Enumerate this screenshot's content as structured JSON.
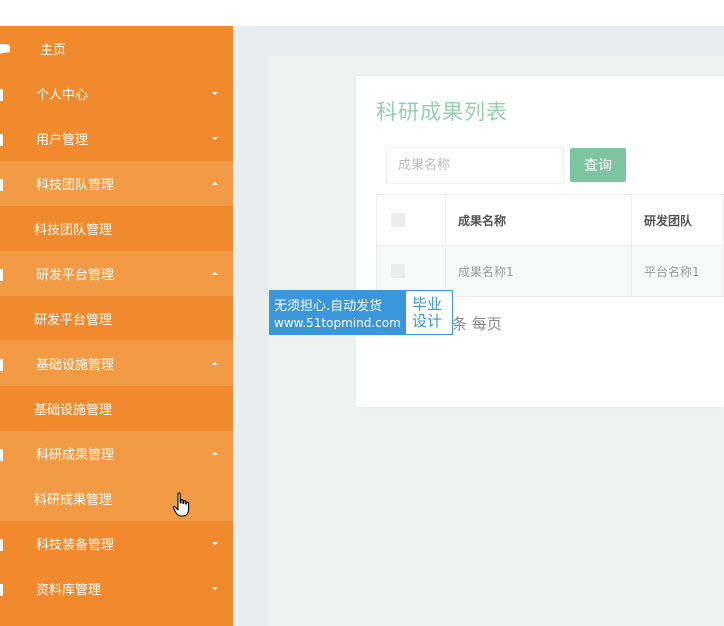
{
  "sidebar": {
    "home": "主页",
    "items": [
      {
        "label": "个人中心",
        "state": "collapsed"
      },
      {
        "label": "用户管理",
        "state": "collapsed"
      },
      {
        "label": "科技团队管理",
        "state": "expanded",
        "sub": "科技团队管理"
      },
      {
        "label": "研发平台管理",
        "state": "expanded",
        "sub": "研发平台管理"
      },
      {
        "label": "基础设施管理",
        "state": "expanded",
        "sub": "基础设施管理"
      },
      {
        "label": "科研成果管理",
        "state": "expanded",
        "sub": "科研成果管理"
      },
      {
        "label": "科技装备管理",
        "state": "collapsed"
      },
      {
        "label": "资料库管理",
        "state": "collapsed"
      }
    ]
  },
  "main": {
    "title": "科研成果列表",
    "search_placeholder": "成果名称",
    "search_button": "查询",
    "table": {
      "headers": [
        "成果名称",
        "研发团队"
      ],
      "rows": [
        [
          "成果名称1",
          "平台名称1"
        ]
      ]
    },
    "pagination_text": "条 每页"
  },
  "watermark": {
    "line1": "无须担心.自动发货",
    "line2": "www.51topmind.com",
    "right1": "毕业",
    "right2": "设计"
  },
  "colors": {
    "sidebar_bg": "#f08a2c",
    "sidebar_open_bg": "#f29a44",
    "title_color": "#96cfb0",
    "button_bg": "#7dc4a3",
    "watermark_blue": "#3a97db"
  }
}
